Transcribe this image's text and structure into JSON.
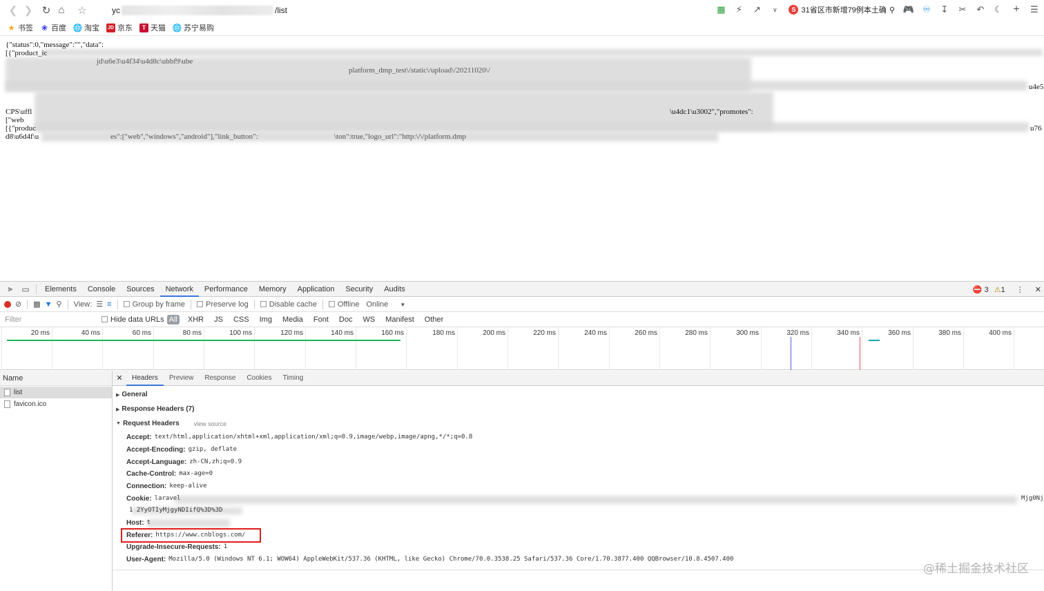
{
  "browser": {
    "address_prefix": "yc",
    "address_suffix": "/list",
    "news_text": "31省区市新增79例本土确",
    "bookmarks": [
      {
        "icon": "star-icon",
        "label": "书签"
      },
      {
        "icon": "baidu-icon",
        "label": "百度"
      },
      {
        "icon": "globe-icon",
        "label": "淘宝"
      },
      {
        "icon": "jd-icon",
        "label": "京东",
        "badge": "JD"
      },
      {
        "icon": "tmall-icon",
        "label": "天猫",
        "badge": "T"
      },
      {
        "icon": "globe-icon",
        "label": "苏宁易购"
      }
    ]
  },
  "page": {
    "json_lines": [
      "{\"status\":0,\"message\":\"\",\"data\":",
      "[{\"product_ic",
      "CPS\\uffl",
      "[\"web",
      "[{\"produc",
      "d8\\u6d4f\\u"
    ],
    "json_fragments": [
      "u4e5",
      "\\u4dc1\\u3002\",\"promotes\":",
      "u76",
      "es\":[\"web\",\"windows\",\"android\"],\"link_button\":",
      "\\ton\":true,\"logo_url\":\"http:\\/\\/platform.dmp",
      "jd\\u6e3\\u4f34\\u4d8c\\ubbf9\\ube",
      "platform_dmp_test\\/static\\/upload\\/20211020\\/"
    ]
  },
  "devtools": {
    "tabs": [
      "Elements",
      "Console",
      "Sources",
      "Network",
      "Performance",
      "Memory",
      "Application",
      "Security",
      "Audits"
    ],
    "active_tab": "Network",
    "errors": "3",
    "warnings": "1",
    "network_bar": {
      "view_label": "View:",
      "group_by_frame": "Group by frame",
      "preserve_log": "Preserve log",
      "disable_cache": "Disable cache",
      "offline": "Offline",
      "throttle": "Online"
    },
    "filter": {
      "placeholder": "Filter",
      "hide_data_urls": "Hide data URLs",
      "types": [
        "All",
        "XHR",
        "JS",
        "CSS",
        "Img",
        "Media",
        "Font",
        "Doc",
        "WS",
        "Manifest",
        "Other"
      ]
    },
    "timeline_ticks": [
      "20 ms",
      "40 ms",
      "60 ms",
      "80 ms",
      "100 ms",
      "120 ms",
      "140 ms",
      "160 ms",
      "180 ms",
      "200 ms",
      "220 ms",
      "240 ms",
      "260 ms",
      "280 ms",
      "300 ms",
      "320 ms",
      "340 ms",
      "360 ms",
      "380 ms",
      "400 ms"
    ],
    "names_header": "Name",
    "requests": [
      "list",
      "favicon.ico"
    ],
    "detail_tabs": [
      "Headers",
      "Preview",
      "Response",
      "Cookies",
      "Timing"
    ],
    "sections": {
      "general": "General",
      "response_headers": "Response Headers (7)",
      "request_headers": "Request Headers",
      "view_source": "view source"
    },
    "headers": [
      {
        "key": "Accept:",
        "value": "text/html,application/xhtml+xml,application/xml;q=0.9,image/webp,image/apng,*/*;q=0.8"
      },
      {
        "key": "Accept-Encoding:",
        "value": "gzip, deflate"
      },
      {
        "key": "Accept-Language:",
        "value": "zh-CN,zh;q=0.9"
      },
      {
        "key": "Cache-Control:",
        "value": "max-age=0"
      },
      {
        "key": "Connection:",
        "value": "keep-alive"
      },
      {
        "key": "Cookie:",
        "value": "laravel"
      },
      {
        "key": "",
        "value": "1                        2YyOTIyMjgyNDIifQ%3D%3D"
      },
      {
        "key": "Host:",
        "value": "                          t"
      },
      {
        "key": "Referer:",
        "value": "https://www.cnblogs.com/"
      },
      {
        "key": "Upgrade-Insecure-Requests:",
        "value": "1"
      },
      {
        "key": "User-Agent:",
        "value": "Mozilla/5.0 (Windows NT 6.1; WOW64) AppleWebKit/537.36 (KHTML, like Gecko) Chrome/70.0.3538.25 Safari/537.36 Core/1.70.3877.400 QQBrowser/10.8.4507.400"
      }
    ],
    "cookie_tail": "Mjg0Nj"
  },
  "watermark": "@稀土掘金技术社区"
}
